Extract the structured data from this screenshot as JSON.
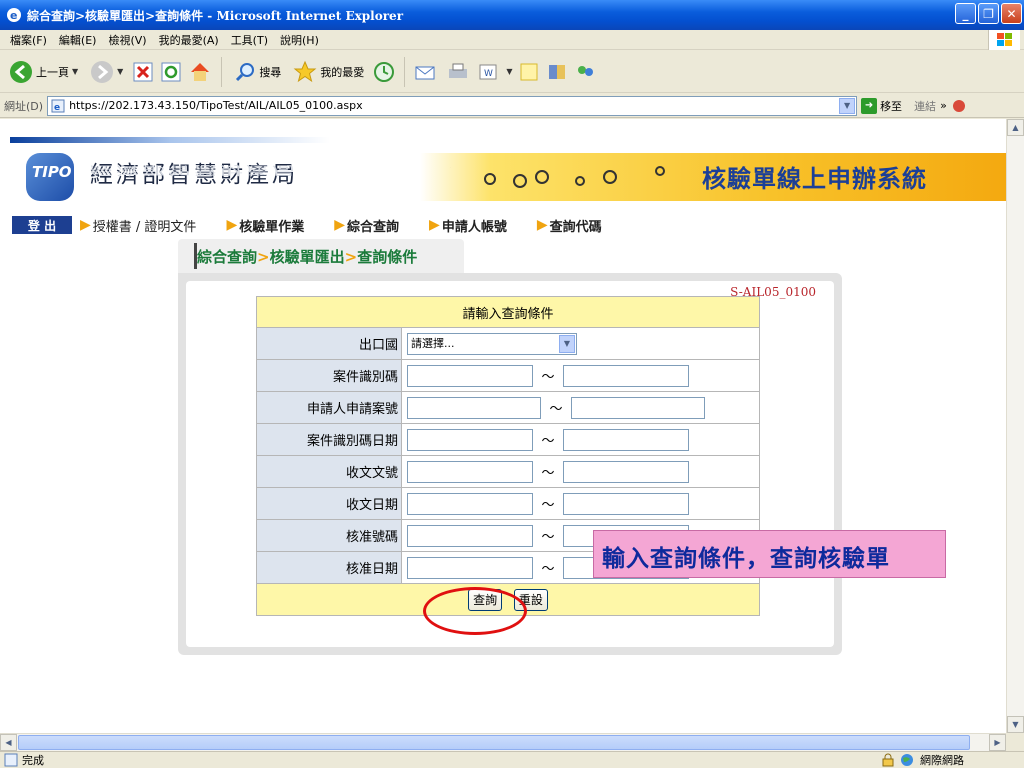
{
  "window": {
    "title": "綜合查詢>核驗單匯出>查詢條件 - Microsoft Internet Explorer"
  },
  "menubar": {
    "items": [
      "檔案(F)",
      "編輯(E)",
      "檢視(V)",
      "我的最愛(A)",
      "工具(T)",
      "說明(H)"
    ]
  },
  "toolbar": {
    "back_label": "上一頁",
    "search_label": "搜尋",
    "favorites_label": "我的最愛"
  },
  "address": {
    "label": "網址(D)",
    "url": "https://202.173.43.150/TipoTest/AIL/AIL05_0100.aspx",
    "go_label": "移至",
    "links_label": "連結"
  },
  "header": {
    "logo_text": "TIPO",
    "org_name": "經濟部智慧財產局",
    "system_name": "核驗單線上申辦系統"
  },
  "nav": {
    "logout_label": "登 出",
    "items": [
      "授權書 / 證明文件",
      "核驗單作業",
      "綜合查詢",
      "申請人帳號",
      "查詢代碼"
    ]
  },
  "page": {
    "crumb_1": "綜合查詢",
    "crumb_2": "核驗單匯出",
    "crumb_3": "查詢條件",
    "crumb_sep": ">",
    "code": "S-AIL05_0100"
  },
  "form": {
    "heading": "請輸入查詢條件",
    "tilde": "～",
    "country_label": "出口國",
    "country_value": "請選擇...",
    "rows": [
      {
        "label": "案件識別碼"
      },
      {
        "label": "申請人申請案號"
      },
      {
        "label": "案件識別碼日期"
      },
      {
        "label": "收文文號"
      },
      {
        "label": "收文日期"
      },
      {
        "label": "核准號碼"
      },
      {
        "label": "核准日期"
      }
    ],
    "query_button": "查詢",
    "reset_button": "重設"
  },
  "annotation": {
    "callout_text": "輸入查詢條件，查詢核驗單"
  },
  "status": {
    "text": "完成",
    "zone": "網際網路"
  }
}
